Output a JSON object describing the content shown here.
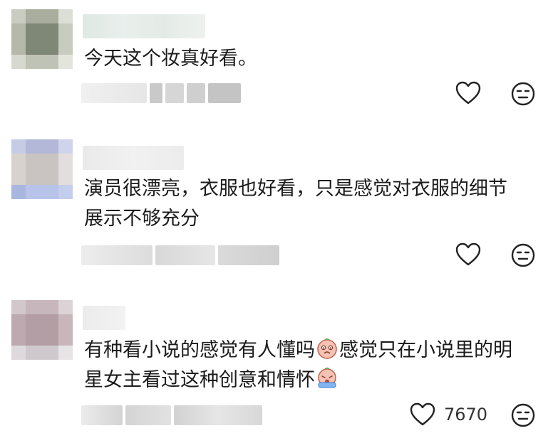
{
  "comments": [
    {
      "text_lines": [
        "今天这个妆真好看。"
      ],
      "like_count": "",
      "avatar_colors": [
        "#c9ccc0",
        "#a9ad9d",
        "#dcdfd6",
        "#b5b9aa",
        "#7f8776",
        "#c8ccbe",
        "#d7d9d1",
        "#bfc3b5",
        "#e3e5dd"
      ]
    },
    {
      "text_lines": [
        "演员很漂亮，衣服也好看，只是感觉对衣服的细节",
        "展示不够充分"
      ],
      "like_count": "",
      "avatar_colors": [
        "#c6cbe6",
        "#b4b8d8",
        "#cfd4ec",
        "#d8d2cf",
        "#c9c3c1",
        "#e2dedd",
        "#a9b6e0",
        "#b7c3e8",
        "#c3cdec"
      ]
    },
    {
      "text_lines": [
        "有种看小说的感觉有人懂吗",
        "感觉只在小说里的明",
        "星女主看过这种创意和情怀"
      ],
      "like_count": "7670",
      "avatar_colors": [
        "#d2c7cb",
        "#c7b6bb",
        "#ddd3d6",
        "#bda9b0",
        "#b29ea4",
        "#c8b6bb",
        "#ddd9dc",
        "#cfc8cc",
        "#e8e4e6"
      ]
    }
  ],
  "icons": {
    "like": "heart-outline-icon",
    "dislike": "neutral-face-icon",
    "emoji_1": "sad-face-sticker-icon",
    "emoji_2": "crying-face-sticker-icon"
  },
  "colors": {
    "icon_stroke": "#222222",
    "text": "#1b1b1b",
    "blur_light": "#e6ebe6"
  }
}
